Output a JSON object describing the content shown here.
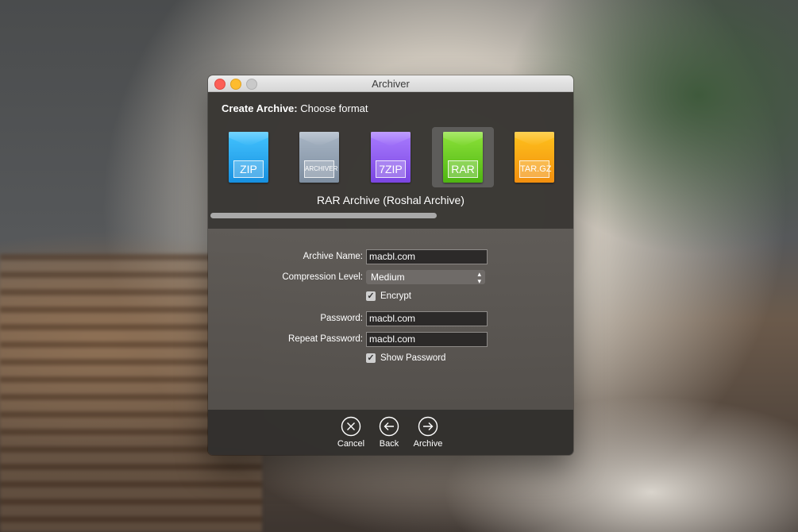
{
  "window": {
    "title": "Archiver"
  },
  "header": {
    "bold": "Create Archive:",
    "rest": " Choose format"
  },
  "formats": [
    {
      "label": "ZIP",
      "color_top": "#44c4ff",
      "color_bottom": "#1790e0",
      "selected": false
    },
    {
      "label": "ARCHIVER",
      "color_top": "#a9b6c5",
      "color_bottom": "#7e8ea0",
      "selected": false
    },
    {
      "label": "7ZIP",
      "color_top": "#a97cff",
      "color_bottom": "#7b46e2",
      "selected": false
    },
    {
      "label": "RAR",
      "color_top": "#8de33a",
      "color_bottom": "#4fb512",
      "selected": true
    },
    {
      "label": "TAR.GZ",
      "color_top": "#ffc21c",
      "color_bottom": "#f28f0f",
      "selected": false
    }
  ],
  "selected_format_name": "RAR Archive (Roshal Archive)",
  "format_scroll": {
    "visible_fraction": 0.62
  },
  "form": {
    "archive_name": {
      "label": "Archive Name:",
      "value": "macbl.com"
    },
    "compression": {
      "label": "Compression Level:",
      "value": "Medium"
    },
    "encrypt": {
      "label": "Encrypt",
      "checked": true
    },
    "password": {
      "label": "Password:",
      "value": "macbl.com"
    },
    "repeat_password": {
      "label": "Repeat Password:",
      "value": "macbl.com"
    },
    "show_password": {
      "label": "Show Password",
      "checked": true
    }
  },
  "actions": {
    "cancel": {
      "label": "Cancel",
      "icon": "cancel-circle-icon"
    },
    "back": {
      "label": "Back",
      "icon": "back-arrow-circle-icon"
    },
    "archive": {
      "label": "Archive",
      "icon": "forward-arrow-circle-icon"
    }
  }
}
